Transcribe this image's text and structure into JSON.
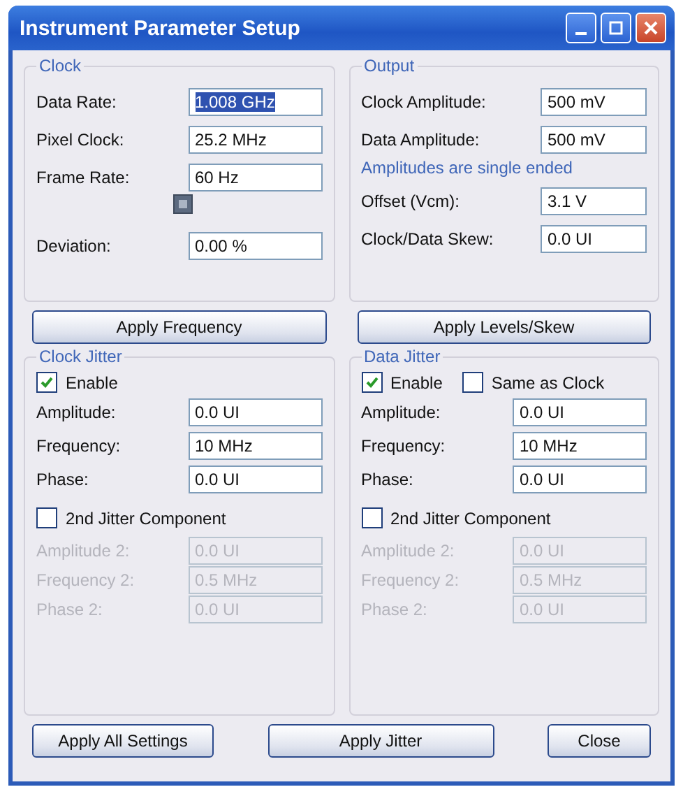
{
  "window": {
    "title": "Instrument Parameter Setup"
  },
  "clock": {
    "title": "Clock",
    "rows": [
      {
        "kind": "field",
        "label": "Data Rate:",
        "value": "1.008 GHz",
        "focused": true
      },
      {
        "kind": "field",
        "label": "Pixel Clock:",
        "value": "25.2 MHz",
        "focused": false
      },
      {
        "kind": "field",
        "label": "Frame Rate:",
        "value": "60 Hz",
        "focused": false
      },
      {
        "kind": "square"
      },
      {
        "kind": "field",
        "label": "Deviation:",
        "value": "0.00 %",
        "focused": false
      }
    ],
    "button": "Apply Frequency"
  },
  "output": {
    "title": "Output",
    "rows": [
      {
        "kind": "field",
        "label": "Clock Amplitude:",
        "value": "500 mV",
        "focused": false
      },
      {
        "kind": "field",
        "label": "Data Amplitude:",
        "value": "500 mV",
        "focused": false
      },
      {
        "kind": "note",
        "label": "Amplitudes are single ended"
      },
      {
        "kind": "field",
        "label": "Offset (Vcm):",
        "value": "3.1 V",
        "focused": false
      },
      {
        "kind": "field",
        "label": "Clock/Data Skew:",
        "value": "0.0 UI",
        "focused": false
      }
    ],
    "button": "Apply Levels/Skew"
  },
  "jitter_groups": [
    {
      "title": "Clock Jitter",
      "checkboxes": [
        {
          "label": "Enable",
          "checked": true
        }
      ],
      "fields": [
        {
          "label": "Amplitude:",
          "value": "0.0 UI",
          "disabled": false
        },
        {
          "label": "Frequency:",
          "value": "10 MHz",
          "disabled": false
        },
        {
          "label": "Phase:",
          "value": "0.0 UI",
          "disabled": false
        }
      ],
      "second": {
        "label": "2nd Jitter Component",
        "checked": false
      },
      "second_fields": [
        {
          "label": "Amplitude 2:",
          "value": "0.0 UI",
          "disabled": true
        },
        {
          "label": "Frequency 2:",
          "value": "0.5 MHz",
          "disabled": true
        },
        {
          "label": "Phase 2:",
          "value": "0.0 UI",
          "disabled": true
        }
      ]
    },
    {
      "title": "Data Jitter",
      "checkboxes": [
        {
          "label": "Enable",
          "checked": true
        },
        {
          "label": "Same as Clock",
          "checked": false
        }
      ],
      "fields": [
        {
          "label": "Amplitude:",
          "value": "0.0 UI",
          "disabled": false
        },
        {
          "label": "Frequency:",
          "value": "10 MHz",
          "disabled": false
        },
        {
          "label": "Phase:",
          "value": "0.0 UI",
          "disabled": false
        }
      ],
      "second": {
        "label": "2nd Jitter Component",
        "checked": false
      },
      "second_fields": [
        {
          "label": "Amplitude 2:",
          "value": "0.0 UI",
          "disabled": true
        },
        {
          "label": "Frequency 2:",
          "value": "0.5 MHz",
          "disabled": true
        },
        {
          "label": "Phase 2:",
          "value": "0.0 UI",
          "disabled": true
        }
      ]
    }
  ],
  "buttons": [
    "Apply All Settings",
    "Apply Jitter",
    "Close"
  ]
}
